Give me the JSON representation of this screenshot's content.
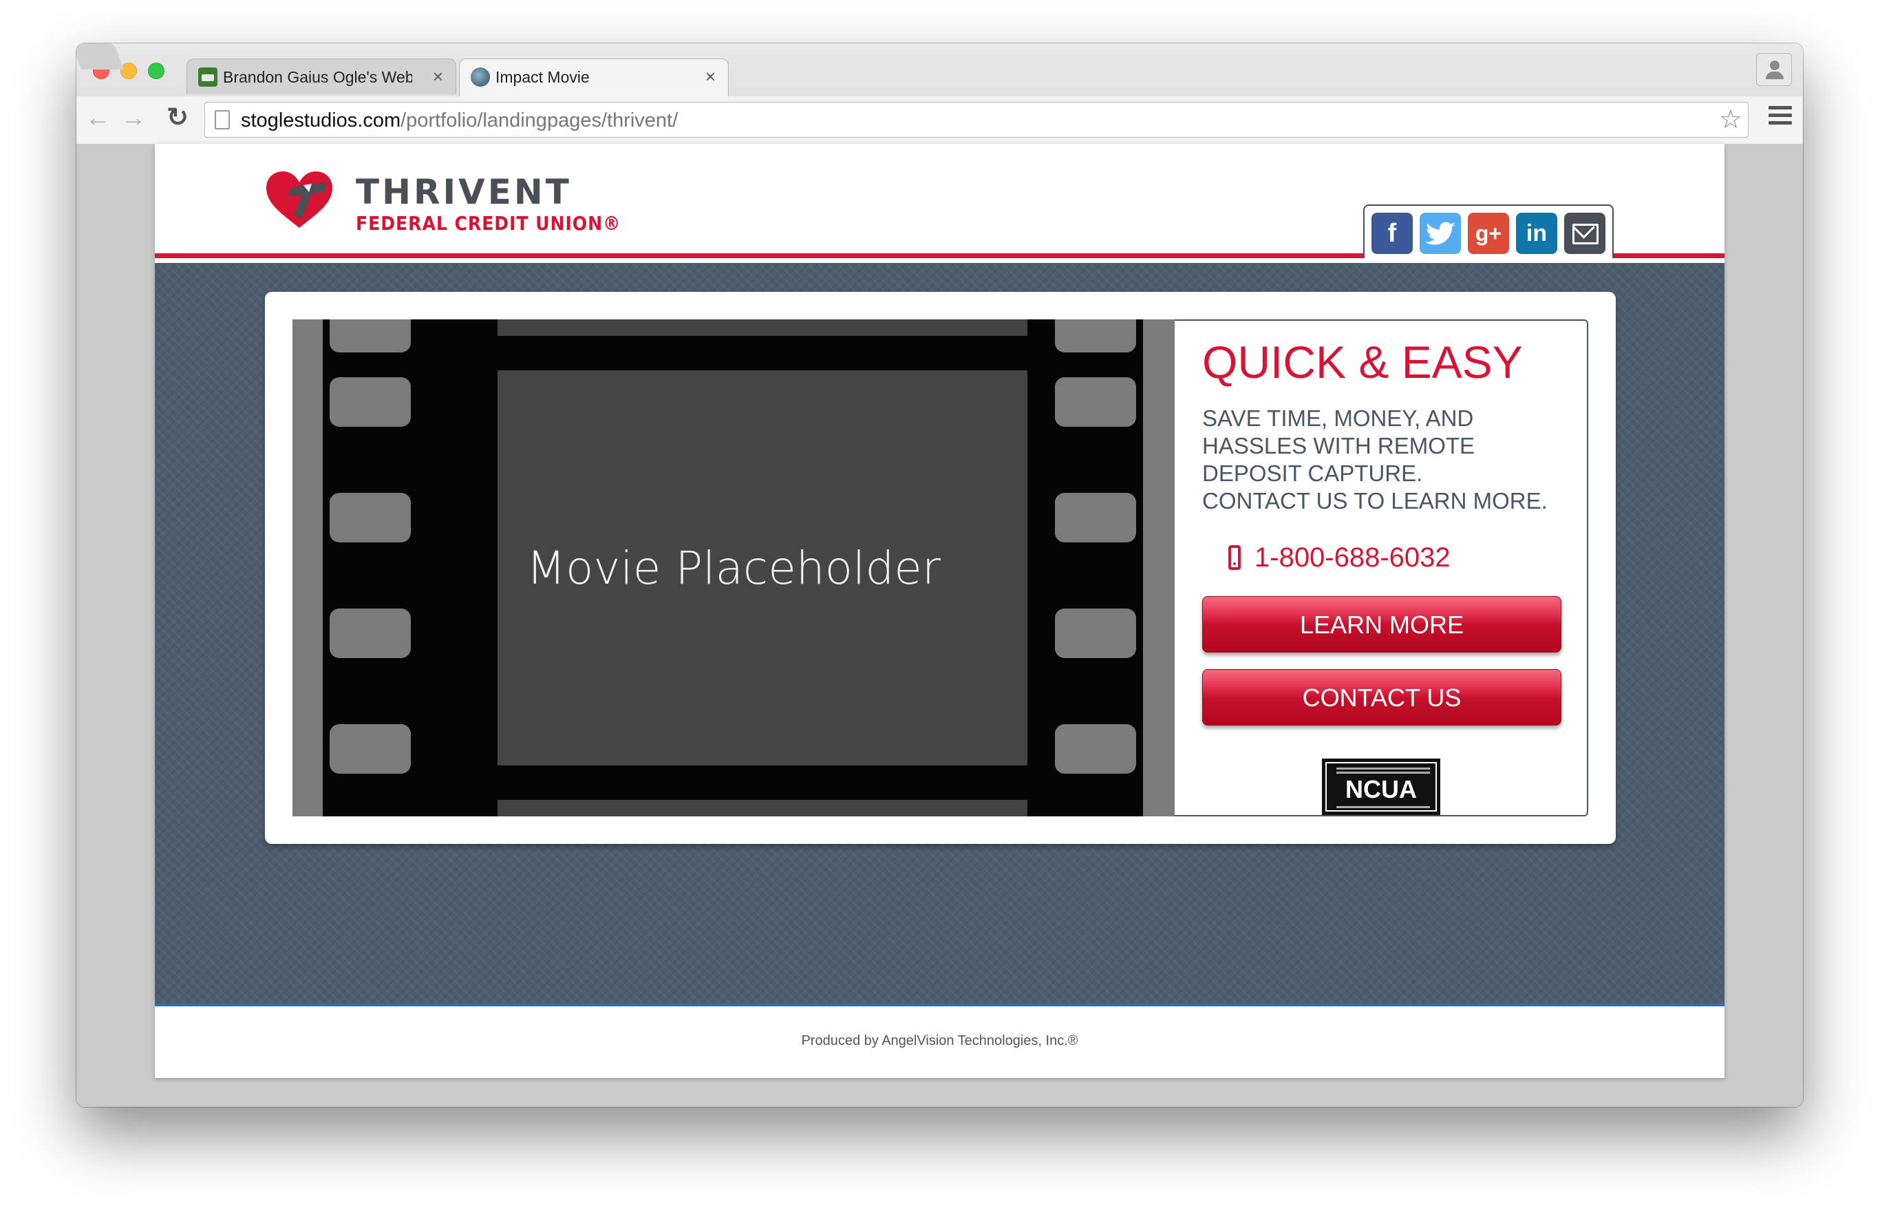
{
  "browser": {
    "tabs": [
      {
        "title": "Brandon Gaius Ogle's Web",
        "close": "×",
        "favicon": "briefcase-icon"
      },
      {
        "title": "Impact Movie",
        "close": "×",
        "favicon": "globe-icon"
      }
    ],
    "nav": {
      "back": "←",
      "forward": "→",
      "reload": "↻"
    },
    "url_host": "stoglestudios.com",
    "url_path": "/portfolio/landingpages/thrivent/",
    "star": "☆"
  },
  "site": {
    "logo_name": "THRIVENT",
    "logo_sub": "FEDERAL CREDIT UNION®",
    "share": [
      {
        "label": "f",
        "icon": "facebook-icon"
      },
      {
        "label": "",
        "icon": "twitter-icon"
      },
      {
        "label": "g+",
        "icon": "google-plus-icon"
      },
      {
        "label": "in",
        "icon": "linkedin-icon"
      },
      {
        "label": "",
        "icon": "email-icon"
      }
    ],
    "movie_label": "Movie Placeholder",
    "headline": "QUICK & EASY",
    "subtext_lines": [
      "SAVE TIME, MONEY, AND",
      "HASSLES WITH REMOTE",
      "DEPOSIT CAPTURE.",
      "CONTACT US TO LEARN MORE."
    ],
    "phone": "1-800-688-6032",
    "learn_more": "LEARN MORE",
    "contact_us": "CONTACT US",
    "ncua": "NCUA",
    "footer": "Produced by AngelVision Technologies, Inc.®"
  },
  "colors": {
    "brand_red": "#d71433",
    "brand_gray": "#4a4e57",
    "band_blue": "#4e5e70"
  }
}
